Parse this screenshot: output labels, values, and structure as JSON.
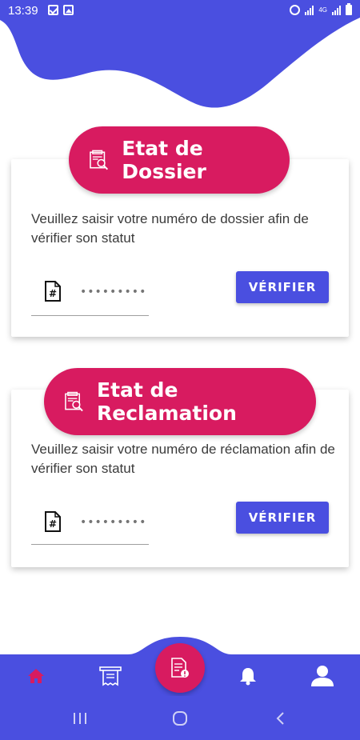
{
  "status_bar": {
    "time": "13:39",
    "network": "4G"
  },
  "colors": {
    "primary": "#4a4fe0",
    "accent": "#d81b60",
    "background": "#ffffff"
  },
  "dossier_card": {
    "title": "Etat de Dossier",
    "title_icon": "document-search-icon",
    "description": "Veuillez saisir votre numéro de dossier afin de vérifier son statut",
    "input_icon": "hash-file-icon",
    "input_placeholder": "•••••••••",
    "button_label": "VÉRIFIER"
  },
  "reclamation_card": {
    "title": "Etat de Reclamation",
    "title_icon": "document-search-icon",
    "description": "Veuillez saisir votre numéro de réclamation afin de vérifier son statut",
    "input_icon": "hash-file-icon",
    "input_placeholder": "•••••••••",
    "button_label": "VÉRIFIER"
  },
  "bottom_nav": {
    "items": [
      {
        "icon": "home-icon",
        "active": true
      },
      {
        "icon": "receipt-icon",
        "active": false
      },
      {
        "icon": "reclamation-doc-icon",
        "active": false,
        "center": true
      },
      {
        "icon": "bell-icon",
        "active": false
      },
      {
        "icon": "user-icon",
        "active": false
      }
    ]
  },
  "system_nav": {
    "items": [
      "recent-apps-icon",
      "home-circle-icon",
      "back-icon"
    ]
  }
}
